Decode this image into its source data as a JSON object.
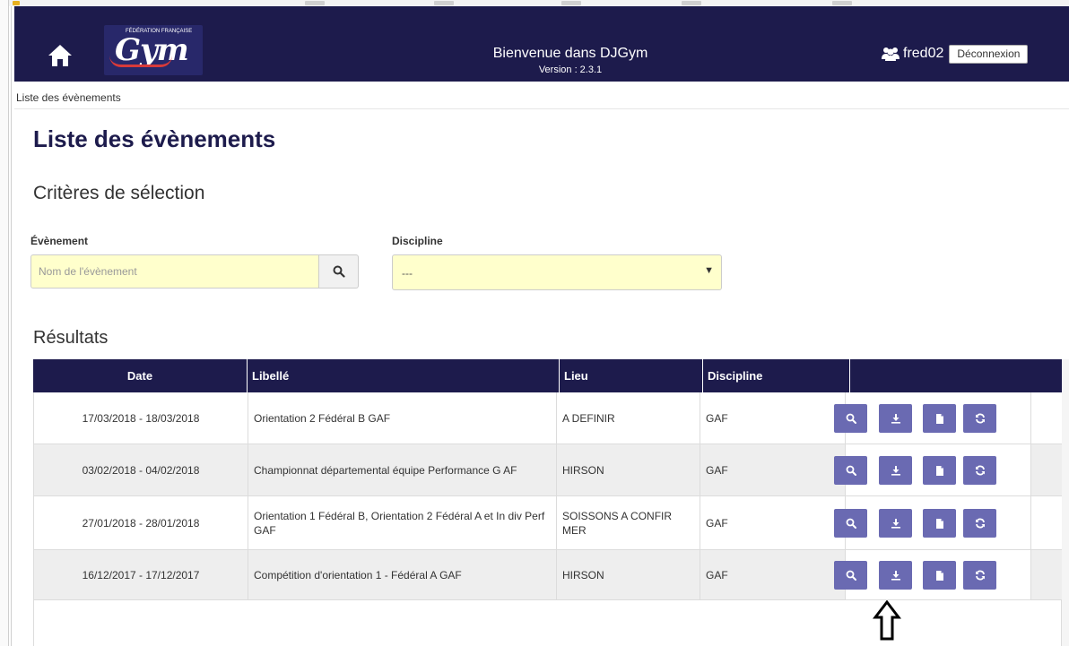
{
  "header": {
    "app_title": "Bienvenue dans DJGym",
    "version": "Version : 2.3.1",
    "username": "fred02",
    "logout_label": "Déconnexion",
    "logo_text": "Gym",
    "logo_small": "FÉDÉRATION FRANÇAISE"
  },
  "breadcrumb": "Liste des évènements",
  "page": {
    "title": "Liste des évènements",
    "criteria_title": "Critères de sélection",
    "results_title": "Résultats"
  },
  "filters": {
    "event_label": "Évènement",
    "event_placeholder": "Nom de l'évènement",
    "event_value": "",
    "discipline_label": "Discipline",
    "discipline_value": "---"
  },
  "table": {
    "headers": {
      "date": "Date",
      "label": "Libellé",
      "place": "Lieu",
      "discipline": "Discipline"
    },
    "rows": [
      {
        "date": "17/03/2018 - 18/03/2018",
        "label": "Orientation 2 Fédéral B GAF",
        "place": "A DEFINIR",
        "discipline": "GAF"
      },
      {
        "date": "03/02/2018 - 04/02/2018",
        "label": "Championnat départemental équipe Performance G AF",
        "place": "HIRSON",
        "discipline": "GAF"
      },
      {
        "date": "27/01/2018 - 28/01/2018",
        "label": "Orientation 1 Fédéral B, Orientation 2 Fédéral A et In div Perf GAF",
        "place": "SOISSONS A CONFIR MER",
        "discipline": "GAF"
      },
      {
        "date": "16/12/2017 - 17/12/2017",
        "label": "Compétition d'orientation 1 - Fédéral A GAF",
        "place": "HIRSON",
        "discipline": "GAF"
      }
    ],
    "row_actions": [
      "search-icon",
      "download-icon",
      "document-icon",
      "refresh-icon"
    ]
  },
  "colors": {
    "navbar": "#1d1b4c",
    "action_button": "#6a6ab2",
    "input_background": "#ffffcc",
    "row_alt": "#eeeeee"
  }
}
